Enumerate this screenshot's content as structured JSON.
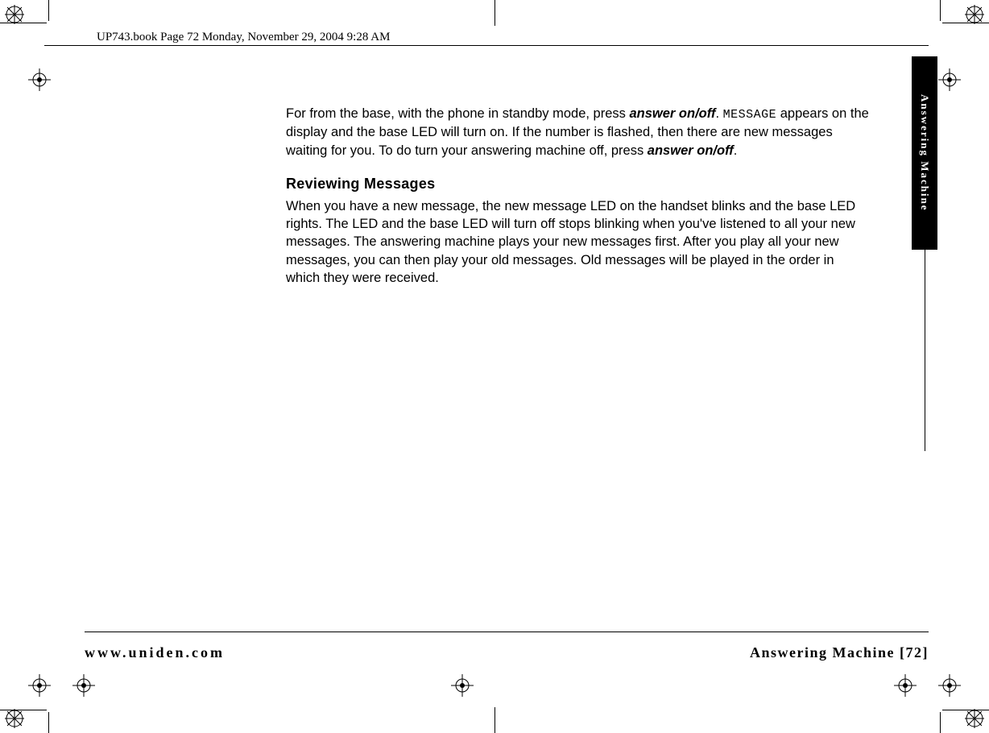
{
  "header": {
    "running_head": "UP743.book  Page 72  Monday, November 29, 2004  9:28 AM"
  },
  "side_tab": {
    "label": "Answering  Machine"
  },
  "content": {
    "para1_pre": "For from the base, with the phone in standby mode, press ",
    "para1_bold1": "answer on/off",
    "para1_mid1": ". ",
    "para1_mono": "MESSAGE",
    "para1_mid2": " appears on the display and the base LED will turn on. If the number is flashed, then there are new messages waiting for you. To do turn your answering machine off, press ",
    "para1_bold2": "answer on/off",
    "para1_post": ".",
    "heading": "Reviewing Messages",
    "para2": "When you have a new message, the new message LED on the handset blinks and the base LED rights. The LED and the base LED will turn off stops blinking when you've listened to all your new messages. The answering machine plays your new messages first. After you play all your new messages, you can then play your old messages. Old messages will be played in the order in which they were received."
  },
  "footer": {
    "left": "www.uniden.com",
    "right": "Answering Machine [72]"
  }
}
